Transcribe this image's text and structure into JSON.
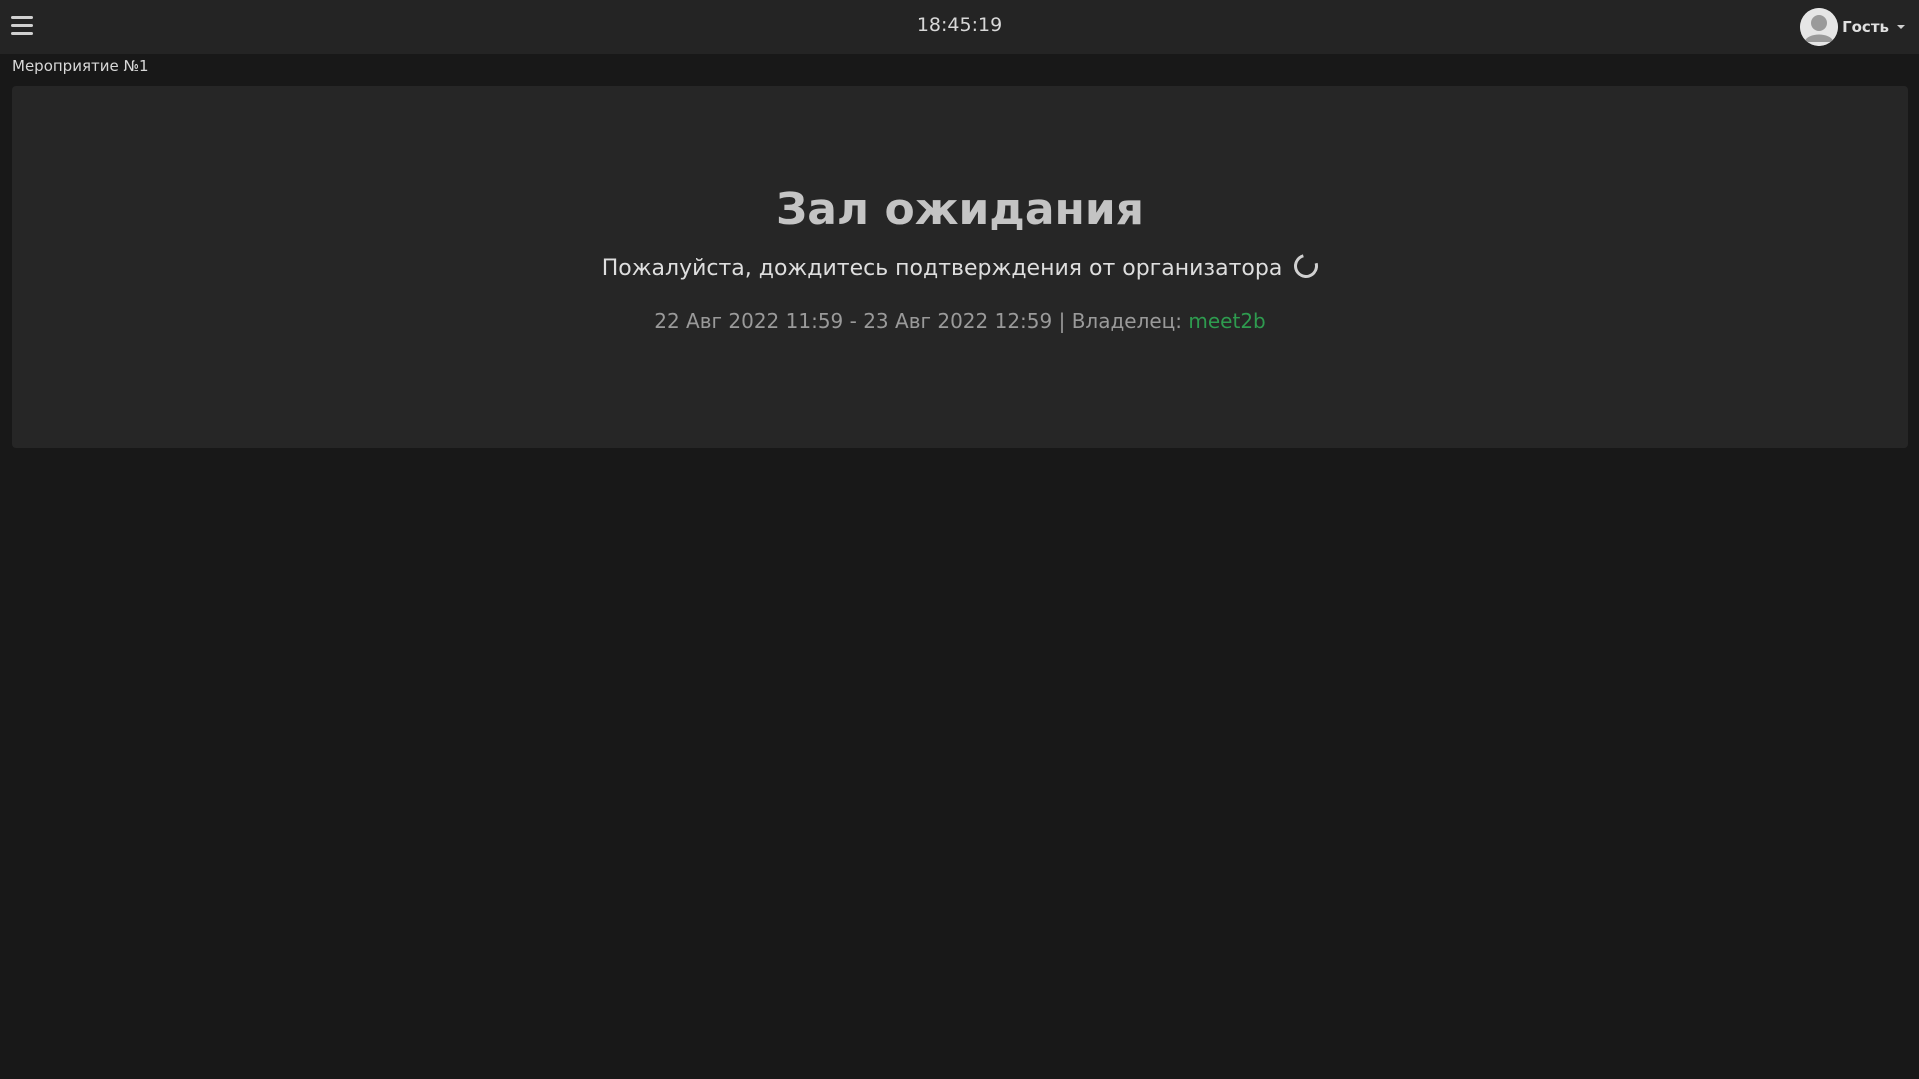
{
  "header": {
    "clock": "18:45:19",
    "user_name": "Гость",
    "menu_icon": "hamburger-icon",
    "avatar_icon": "user-avatar-icon"
  },
  "breadcrumb": {
    "event_name": "Мероприятие №1"
  },
  "waiting_room": {
    "title": "Зал ожидания",
    "subtitle": "Пожалуйста, дождитесь подтверждения от организатора",
    "date_range": "22 Авг 2022 11:59 - 23 Авг 2022 12:59",
    "separator": " | ",
    "owner_label": "Владелец: ",
    "owner_name": "meet2b"
  },
  "colors": {
    "background": "#181818",
    "topbar": "#242424",
    "panel": "#262626",
    "accent_link": "#2e9b4f"
  }
}
